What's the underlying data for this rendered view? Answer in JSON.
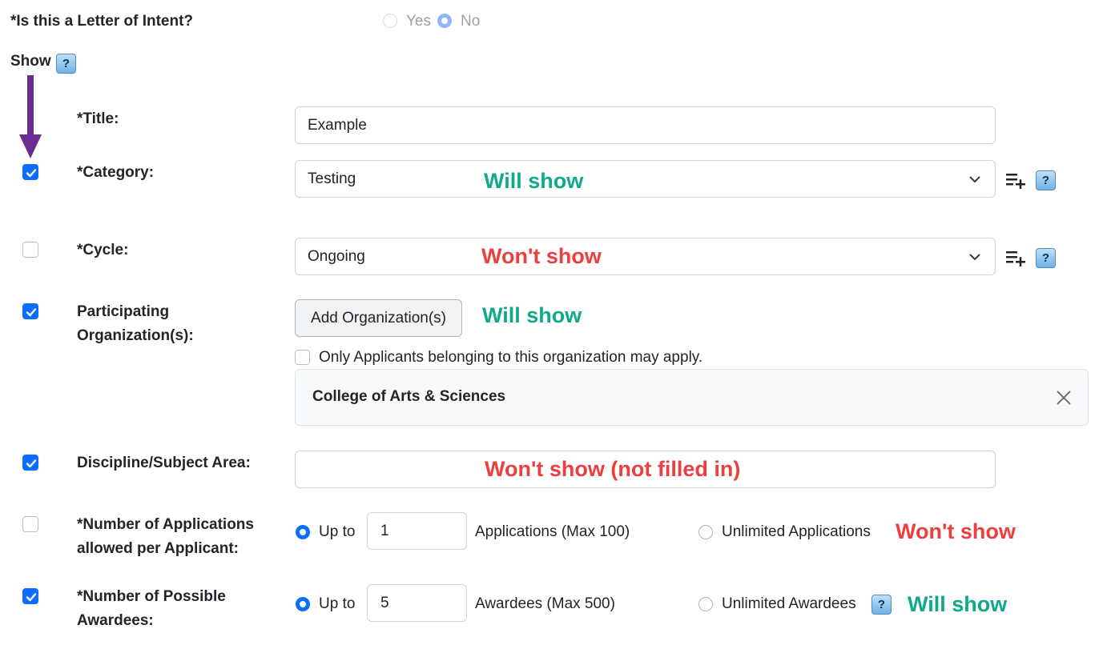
{
  "loi": {
    "label": "*Is this a Letter of Intent?",
    "yes_label": "Yes",
    "no_label": "No",
    "selected": "No"
  },
  "show": {
    "label": "Show",
    "help": "?"
  },
  "fields": {
    "title": {
      "label": "*Title:",
      "value": "Example"
    },
    "category": {
      "label": "*Category:",
      "value": "Testing",
      "checked": true,
      "note": "Will show"
    },
    "cycle": {
      "label": "*Cycle:",
      "value": "Ongoing",
      "checked": false,
      "note": "Won't show"
    },
    "orgs": {
      "label_line1": "Participating",
      "label_line2": "Organization(s):",
      "checked": true,
      "button_label": "Add Organization(s)",
      "note": "Will show",
      "only_applicants_label": "Only Applicants belonging to this organization may apply.",
      "org_name": "College of Arts & Sciences"
    },
    "discipline": {
      "label": "Discipline/Subject Area:",
      "checked": true,
      "value": "",
      "note": "Won't show (not filled in)"
    },
    "apps": {
      "label_line1": "*Number of Applications",
      "label_line2": "allowed per Applicant:",
      "checked": false,
      "up_to_label": "Up to",
      "value": "1",
      "suffix": "Applications (Max 100)",
      "unlimited_label": "Unlimited Applications",
      "note": "Won't show"
    },
    "awardees": {
      "label_line1": "*Number of Possible",
      "label_line2": "Awardees:",
      "checked": true,
      "up_to_label": "Up to",
      "value": "5",
      "suffix": "Awardees (Max 500)",
      "unlimited_label": "Unlimited Awardees",
      "note": "Will show"
    }
  },
  "colors": {
    "arrow": "#6a2c91",
    "will_show": "#10a98a",
    "wont_show": "#ee3e3e",
    "checkbox_on": "#0d6efd"
  },
  "icons": [
    "arrow-down-annotation",
    "list-add-icon",
    "help-icon",
    "chevron-down-icon",
    "close-icon",
    "check-icon"
  ]
}
